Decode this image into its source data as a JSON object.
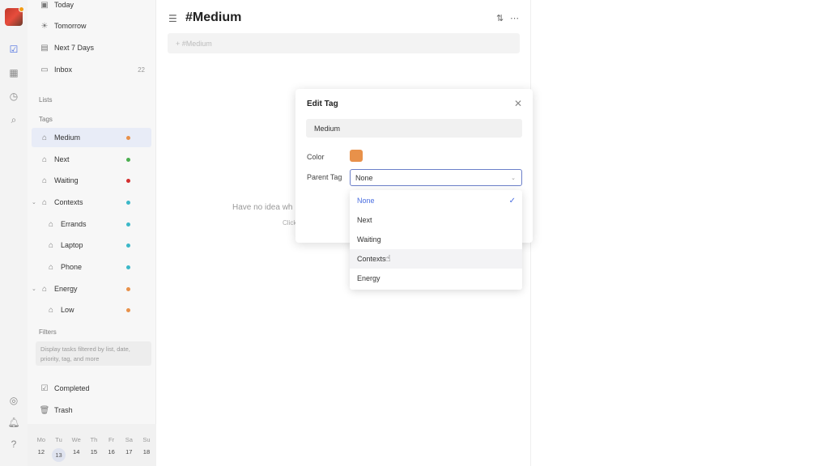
{
  "sidebar": {
    "smart": [
      {
        "label": "Today",
        "icon": "calendar-today-icon"
      },
      {
        "label": "Tomorrow",
        "icon": "sunrise-icon"
      },
      {
        "label": "Next 7 Days",
        "icon": "calendar-week-icon"
      },
      {
        "label": "Inbox",
        "icon": "inbox-icon",
        "count": "22"
      }
    ],
    "lists_label": "Lists",
    "tags_label": "Tags",
    "tags": [
      {
        "label": "Medium",
        "color": "#e8914a"
      },
      {
        "label": "Next",
        "color": "#4caf50"
      },
      {
        "label": "Waiting",
        "color": "#d32f2f"
      },
      {
        "label": "Contexts",
        "color": "#3cb8c8"
      },
      {
        "label": "Errands",
        "color": "#3cb8c8"
      },
      {
        "label": "Laptop",
        "color": "#3cb8c8"
      },
      {
        "label": "Phone",
        "color": "#3cb8c8"
      },
      {
        "label": "Energy",
        "color": "#e8914a"
      },
      {
        "label": "Low",
        "color": "#e8914a"
      }
    ],
    "filters_label": "Filters",
    "filters_hint": "Display tasks filtered by list, date, priority, tag, and more",
    "completed_label": "Completed",
    "trash_label": "Trash"
  },
  "calendar": {
    "weekdays": [
      "Mo",
      "Tu",
      "We",
      "Th",
      "Fr",
      "Sa",
      "Su"
    ],
    "dates": [
      "12",
      "13",
      "14",
      "15",
      "16",
      "17",
      "18"
    ],
    "today": "13"
  },
  "main": {
    "title": "#Medium",
    "add_placeholder": "+ #Medium",
    "empty_line1": "Have no idea wh",
    "empty_line2": "Click"
  },
  "modal": {
    "title": "Edit Tag",
    "name_value": "Medium",
    "color_label": "Color",
    "color_value": "#e8914a",
    "parent_label": "Parent Tag",
    "parent_value": "None",
    "options": [
      "None",
      "Next",
      "Waiting",
      "Contexts",
      "Energy"
    ],
    "selected_option": "None",
    "hovered_option": "Contexts"
  }
}
